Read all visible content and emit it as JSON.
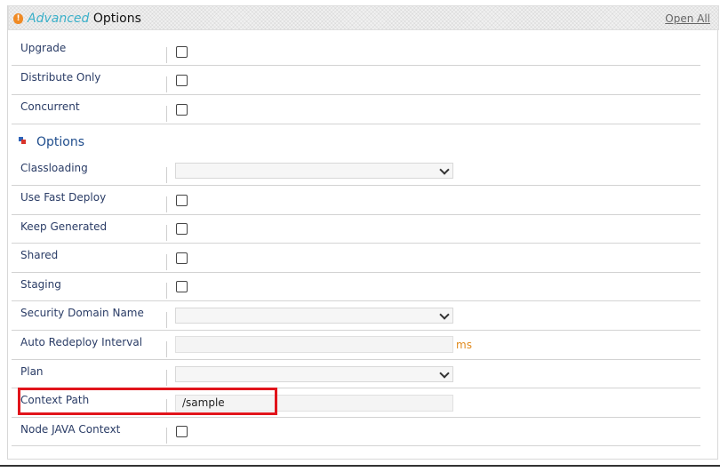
{
  "header": {
    "icon": "alert-badge-icon",
    "title_accent": "Advanced",
    "title_rest": "Options",
    "open_all_label": "Open All",
    "accent_color": "#3bb0c9"
  },
  "top_rows": [
    {
      "label": "Upgrade",
      "control": "checkbox",
      "checked": false
    },
    {
      "label": "Distribute Only",
      "control": "checkbox",
      "checked": false
    },
    {
      "label": "Concurrent",
      "control": "checkbox",
      "checked": false
    }
  ],
  "options_section": {
    "title": "Options",
    "icon": "stacked-squares-icon",
    "rows": [
      {
        "label": "Classloading",
        "control": "select",
        "value": ""
      },
      {
        "label": "Use Fast Deploy",
        "control": "checkbox",
        "checked": false
      },
      {
        "label": "Keep Generated",
        "control": "checkbox",
        "checked": false
      },
      {
        "label": "Shared",
        "control": "checkbox",
        "checked": false
      },
      {
        "label": "Staging",
        "control": "checkbox",
        "checked": false
      },
      {
        "label": "Security Domain Name",
        "control": "select",
        "value": ""
      },
      {
        "label": "Auto Redeploy Interval",
        "control": "text",
        "value": "",
        "unit": "ms"
      },
      {
        "label": "Plan",
        "control": "select",
        "value": ""
      },
      {
        "label": "Context Path",
        "control": "text",
        "value": "/sample"
      },
      {
        "label": "Node JAVA Context",
        "control": "checkbox",
        "checked": false
      }
    ]
  },
  "highlight_color": "#e1141b"
}
